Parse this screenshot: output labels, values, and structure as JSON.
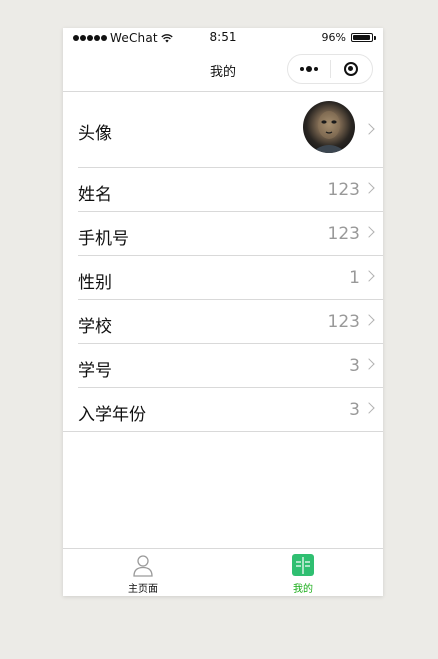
{
  "status_bar": {
    "carrier": "WeChat",
    "time": "8:51",
    "battery": "96%",
    "battery_level": 0.96
  },
  "nav": {
    "title": "我的",
    "more_icon": "more-dots-icon",
    "close_icon": "target-close-icon"
  },
  "profile": {
    "avatar_label": "头像",
    "rows": [
      {
        "label": "姓名",
        "value": "123"
      },
      {
        "label": "手机号",
        "value": "123"
      },
      {
        "label": "性别",
        "value": "1"
      },
      {
        "label": "学校",
        "value": "123"
      },
      {
        "label": "学号",
        "value": "3"
      },
      {
        "label": "入学年份",
        "value": "3"
      }
    ]
  },
  "tabbar": {
    "tabs": [
      {
        "label": "主页面",
        "icon": "user-outline-icon",
        "active": false
      },
      {
        "label": "我的",
        "icon": "book-icon",
        "active": true
      }
    ]
  },
  "colors": {
    "accent": "#1aad19",
    "tab_icon_active": "#2fbf71",
    "value_text": "#999999",
    "background": "#ecebe7"
  }
}
